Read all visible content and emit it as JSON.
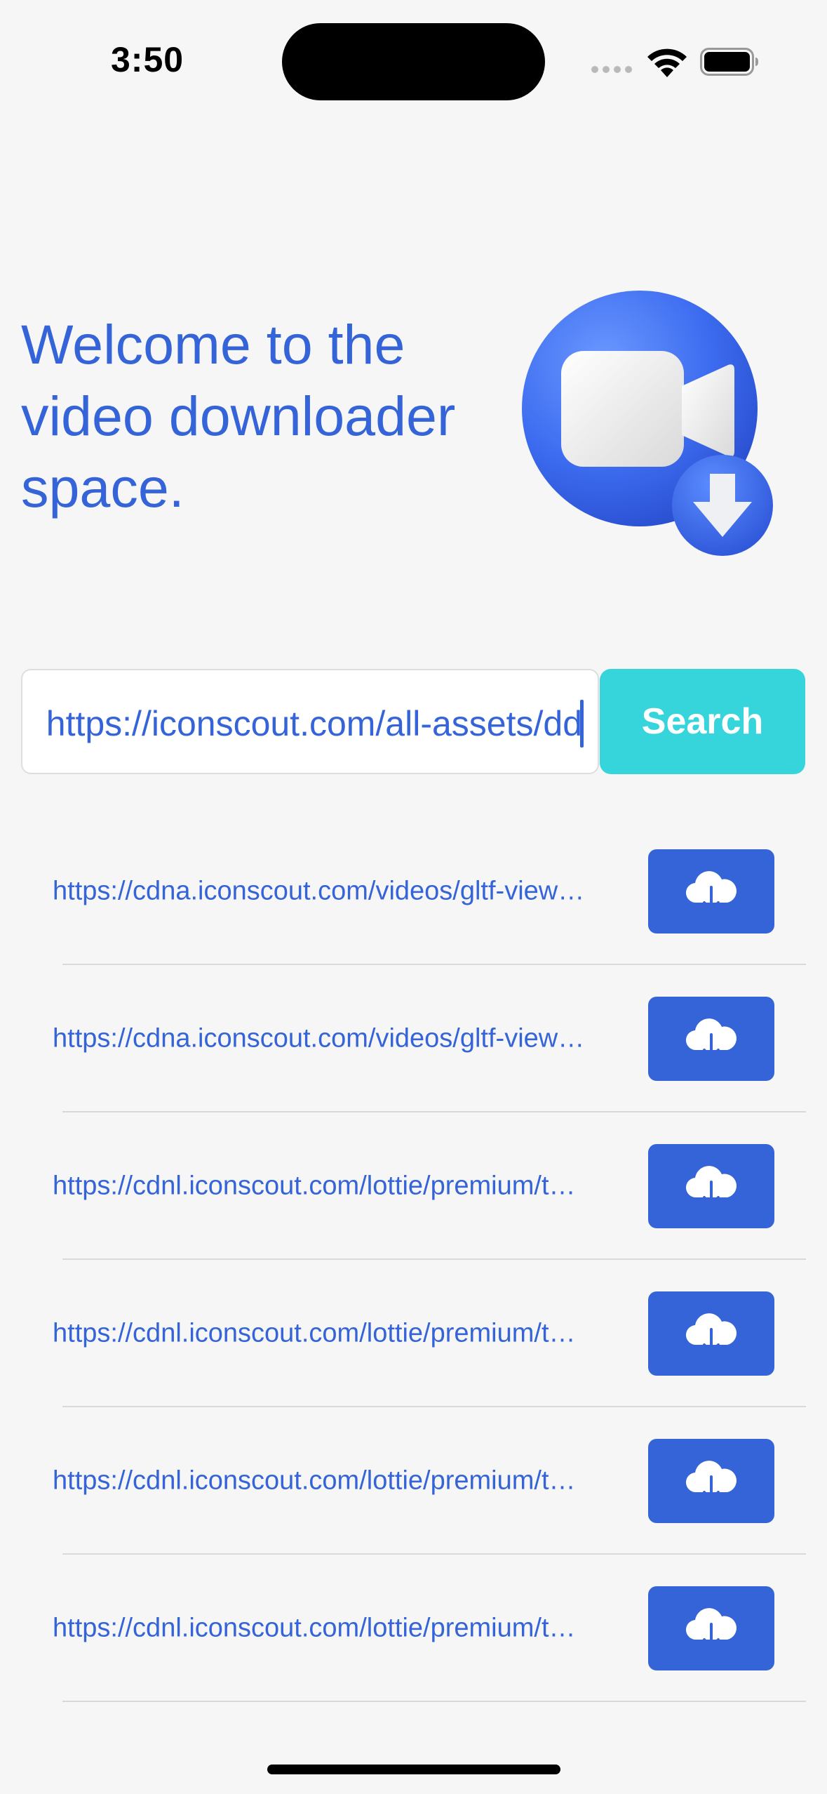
{
  "status_bar": {
    "time": "3:50",
    "icons": [
      "cellular-signal-icon",
      "wifi-icon",
      "battery-icon"
    ]
  },
  "hero": {
    "welcome_text": "Welcome to the video downloader space.",
    "illustration": "video-camera-download-icon"
  },
  "search": {
    "input_value": "https://iconscout.com/all-assets/dd",
    "button_label": "Search"
  },
  "results": [
    {
      "url": "https://cdna.iconscout.com/videos/gltf-view…",
      "icon": "cloud-download-icon"
    },
    {
      "url": "https://cdna.iconscout.com/videos/gltf-view…",
      "icon": "cloud-download-icon"
    },
    {
      "url": "https://cdnl.iconscout.com/lottie/premium/t…",
      "icon": "cloud-download-icon"
    },
    {
      "url": "https://cdnl.iconscout.com/lottie/premium/t…",
      "icon": "cloud-download-icon"
    },
    {
      "url": "https://cdnl.iconscout.com/lottie/premium/t…",
      "icon": "cloud-download-icon"
    },
    {
      "url": "https://cdnl.iconscout.com/lottie/premium/t…",
      "icon": "cloud-download-icon"
    }
  ],
  "colors": {
    "accent_blue": "#3564d8",
    "search_button": "#36d5db",
    "background": "#f6f6f6"
  }
}
